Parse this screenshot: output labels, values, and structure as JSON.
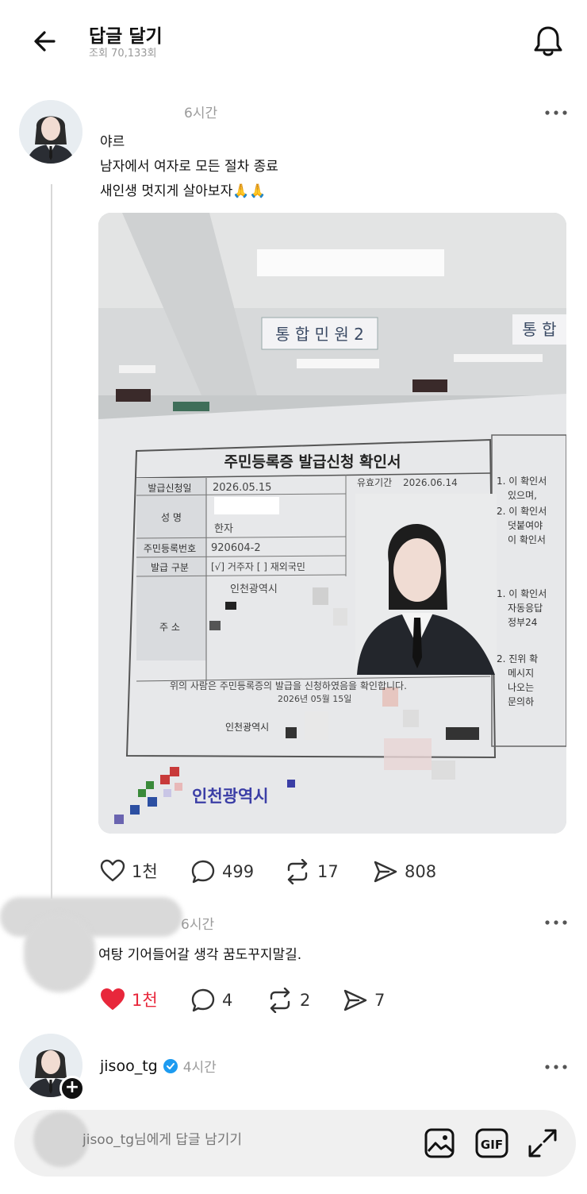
{
  "header": {
    "title": "답글 달기",
    "views": "조회 70,133회"
  },
  "post": {
    "time": "6시간",
    "lines": [
      "야르",
      "남자에서 여자로 모든 절차 종료",
      "새인생 멋지게 살아보자🙏🙏"
    ],
    "photo": {
      "sign_left": "통 합 민 원 2",
      "sign_right": "통 합",
      "doc_title": "주민등록증 발급신청 확인서",
      "rows": [
        {
          "label": "발급신청일",
          "value": "2026.05.15"
        },
        {
          "label": "성  명",
          "value": "한자"
        },
        {
          "label": "주민등록번호",
          "value": "920604-2"
        },
        {
          "label": "발급 구분",
          "value": "[√] 거주자 [  ] 재외국민"
        },
        {
          "label": "주  소",
          "value": "인천광역시"
        }
      ],
      "validity_label": "유효기간",
      "validity_value": "2026.06.14",
      "footer_sentence": "위의 사람은 주민등록증의 발급을 신청하였음을 확인합니다.",
      "footer_date": "2026년 05월 15일",
      "footer_city": "인천광역시",
      "side_notes": [
        "1. 이 확인서",
        "있으며,",
        "2. 이 확인서",
        "덧붙여야",
        "이 확인서",
        "1. 이 확인서",
        "자동응답",
        "정부24",
        "2. 진위 확",
        "메시지",
        "나오는",
        "문의하"
      ],
      "logo_text": "인천광역시"
    },
    "actions": {
      "likes": "1천",
      "comments": "499",
      "reposts": "17",
      "shares": "808"
    }
  },
  "reply": {
    "time": "6시간",
    "text": "여탕 기어들어갈 생각 꿈도꾸지말길.",
    "actions": {
      "likes": "1천",
      "comments": "4",
      "reposts": "2",
      "shares": "7"
    }
  },
  "compose": {
    "username": "jisoo_tg",
    "time": "4시간",
    "placeholder": "jisoo_tg님에게 답글 남기기"
  },
  "colors": {
    "like_active": "#e8273b",
    "verified": "#1d9bf0",
    "muted": "#9b9b9b"
  }
}
